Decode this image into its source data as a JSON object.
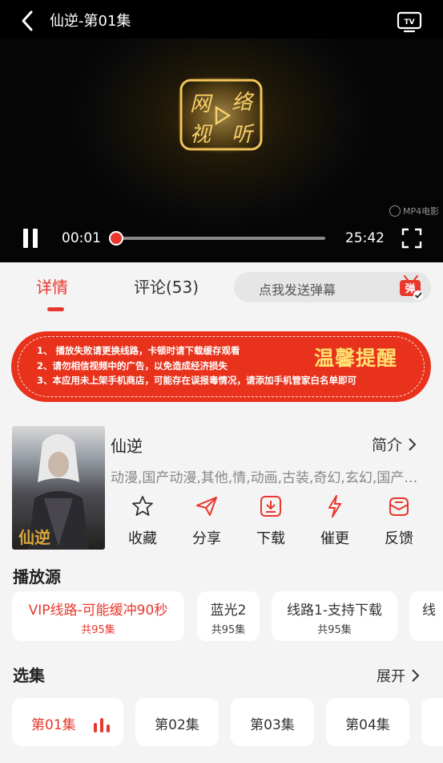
{
  "player": {
    "title": "仙逆-第01集",
    "current_time": "00:01",
    "total_time": "25:42",
    "progress_fraction": 0.0,
    "watermark": "MP4电影",
    "logo_text": "网络视听"
  },
  "tabs": {
    "details_label": "详情",
    "comments_label": "评论(53)"
  },
  "danmu": {
    "placeholder": "点我发送弹幕",
    "icon_label": "弹"
  },
  "notice": {
    "lines": [
      "1、 播放失败请更换线路，卡顿时请下载缓存观看",
      "2、请勿相信视频中的广告，以免造成经济损失",
      "3、本应用未上架手机商店，可能存在误报毒情况，请添加手机管家白名单即可"
    ],
    "title": "温馨提醒"
  },
  "info": {
    "poster_text": "仙逆",
    "name": "仙逆",
    "intro_label": "简介",
    "tags": "动漫,国产动漫,其他,情,动画,古装,奇幻,玄幻,国产动漫",
    "actions": [
      {
        "label": "收藏",
        "icon": "star-icon"
      },
      {
        "label": "分享",
        "icon": "share-icon"
      },
      {
        "label": "下载",
        "icon": "download-icon"
      },
      {
        "label": "催更",
        "icon": "lightning-icon"
      },
      {
        "label": "反馈",
        "icon": "feedback-icon"
      }
    ]
  },
  "sources": {
    "title": "播放源",
    "items": [
      {
        "name": "VIP线路-可能缓冲90秒",
        "count": "共95集"
      },
      {
        "name": "蓝光2",
        "count": "共95集"
      },
      {
        "name": "线路1-支持下载",
        "count": "共95集"
      },
      {
        "name": "线",
        "count": ""
      }
    ]
  },
  "episodes": {
    "title": "选集",
    "expand_label": "展开",
    "items": [
      "第01集",
      "第02集",
      "第03集",
      "第04集"
    ]
  },
  "colors": {
    "accent": "#e8372c",
    "notice_bg": "#e8321c",
    "notice_title": "#ffe070"
  }
}
